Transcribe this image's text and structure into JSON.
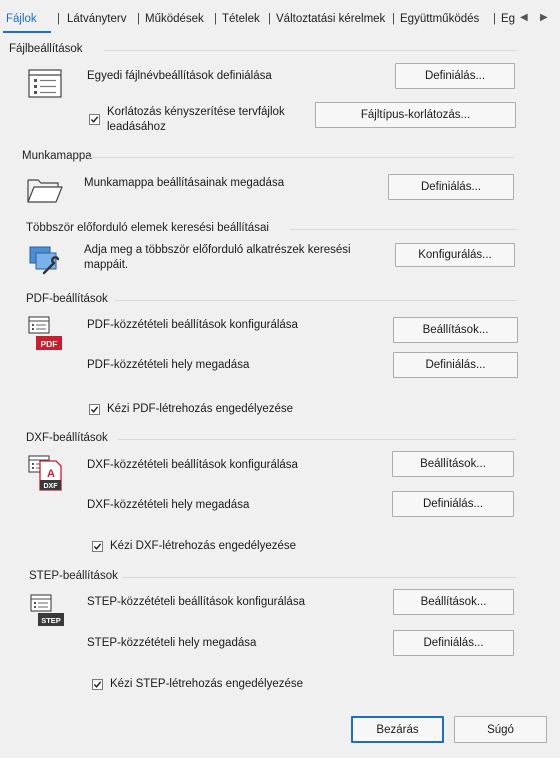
{
  "tabs": [
    {
      "label": "Fájlok",
      "active": true
    },
    {
      "label": "Látványterv"
    },
    {
      "label": "Működések"
    },
    {
      "label": "Tételek"
    },
    {
      "label": "Változtatási kérelmek"
    },
    {
      "label": "Együttműködés"
    },
    {
      "label": "Eg"
    }
  ],
  "sections": {
    "files": {
      "title": "Fájlbeállítások",
      "name_label": "Egyedi fájlnévbeállítások definiálása",
      "name_button": "Definiálás...",
      "restrict_checkbox": "Korlátozás kényszerítése tervfájlok leadásához",
      "restrict_checked": true,
      "restrict_button": "Fájltípus-korlátozás..."
    },
    "workspace": {
      "title": "Munkamappa",
      "label": "Munkamappa beállításainak megadása",
      "button": "Definiálás..."
    },
    "multi": {
      "title": "Többször előforduló elemek keresési beállításai",
      "label": "Adja meg a többször előforduló alkatrészek keresési mappáit.",
      "button": "Konfigurálás..."
    },
    "pdf": {
      "title": "PDF-beállítások",
      "config_label": "PDF-közzétételi beállítások konfigurálása",
      "config_button": "Beállítások...",
      "location_label": "PDF-közzétételi hely megadása",
      "location_button": "Definiálás...",
      "checkbox": "Kézi PDF-létrehozás engedélyezése",
      "checked": true,
      "icon_text": "PDF"
    },
    "dxf": {
      "title": "DXF-beállítások",
      "config_label": "DXF-közzétételi beállítások konfigurálása",
      "config_button": "Beállítások...",
      "location_label": "DXF-közzétételi hely megadása",
      "location_button": "Definiálás...",
      "checkbox": "Kézi DXF-létrehozás engedélyezése",
      "checked": true,
      "icon_text": "DXF"
    },
    "step": {
      "title": "STEP-beállítások",
      "config_label": "STEP-közzétételi beállítások konfigurálása",
      "config_button": "Beállítások...",
      "location_label": "STEP-közzétételi hely megadása",
      "location_button": "Definiálás...",
      "checkbox": "Kézi STEP-létrehozás engedélyezése",
      "checked": true,
      "icon_text": "STEP"
    }
  },
  "footer": {
    "close": "Bezárás",
    "help": "Súgó"
  },
  "colors": {
    "accent": "#1a6fc4",
    "pdf_red": "#c8202f",
    "step_dark": "#3a3a3a"
  }
}
